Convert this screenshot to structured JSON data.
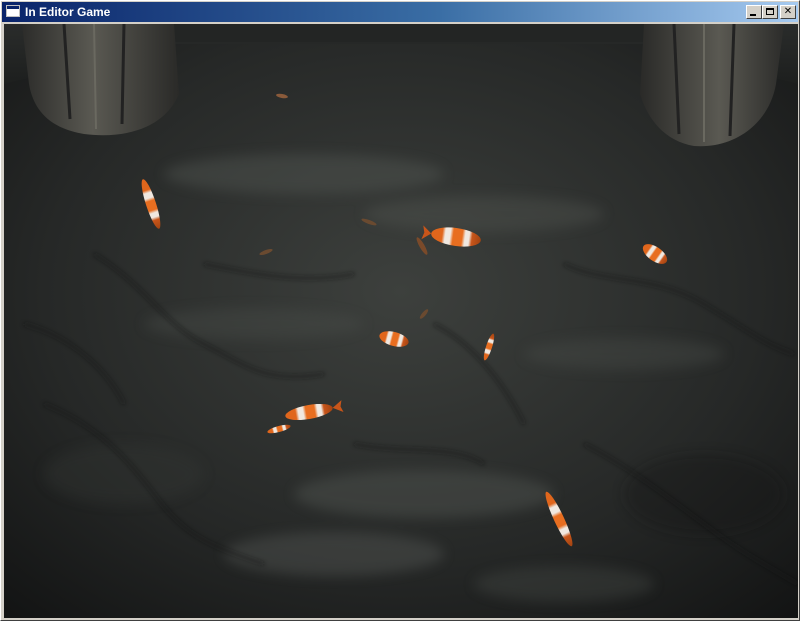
{
  "window": {
    "title": "In Editor Game",
    "controls": {
      "minimize": "minimize",
      "maximize": "maximize",
      "close": "close"
    }
  },
  "scene": {
    "description_icons": [
      "app-window-icon"
    ],
    "fish_count": 13,
    "colors": {
      "water_dark": "#1a1c1c",
      "water_mid": "#3a3d3a",
      "pillar": "#4a4a45",
      "fish_orange": "#e0661c",
      "fish_white": "#f0e8e0",
      "titlebar_start": "#0a246a",
      "titlebar_end": "#a6caf0"
    }
  }
}
